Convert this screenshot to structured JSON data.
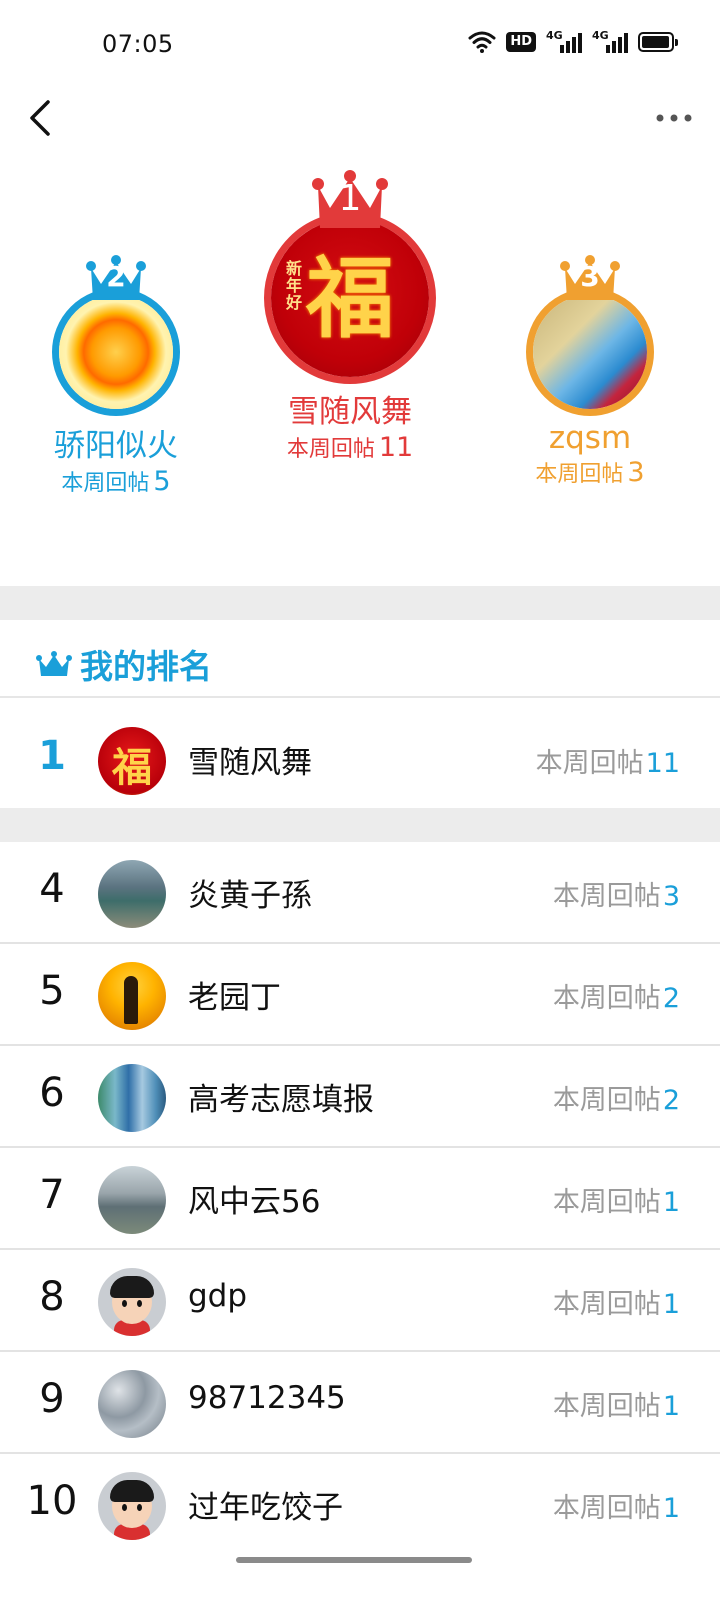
{
  "status": {
    "time": "07:05",
    "hd_label": "HD",
    "sim1_label": "4G",
    "sim2_label": "4G"
  },
  "header": {
    "back_icon": "chevron-left-icon",
    "more_icon": "more-dots-icon"
  },
  "podium": {
    "first": {
      "rank": "1",
      "name": "雪随风舞",
      "count_label": "本周回帖",
      "count": "11",
      "color": "#e23a3a",
      "avatar_text": "福",
      "avatar_side_text": "新年好"
    },
    "second": {
      "rank": "2",
      "name": "骄阳似火",
      "count_label": "本周回帖",
      "count": "5",
      "color": "#1a9fd9"
    },
    "third": {
      "rank": "3",
      "name": "zqsm",
      "count_label": "本周回帖",
      "count": "3",
      "color": "#f0a030"
    }
  },
  "my_rank": {
    "title": "我的排名",
    "rank": "1",
    "name": "雪随风舞",
    "count_label": "本周回帖",
    "count": "11",
    "avatar_text": "福"
  },
  "list": [
    {
      "rank": "4",
      "name": "炎黄子孫",
      "count_label": "本周回帖",
      "count": "3"
    },
    {
      "rank": "5",
      "name": "老园丁",
      "count_label": "本周回帖",
      "count": "2"
    },
    {
      "rank": "6",
      "name": "高考志愿填报",
      "count_label": "本周回帖",
      "count": "2"
    },
    {
      "rank": "7",
      "name": "风中云56",
      "count_label": "本周回帖",
      "count": "1"
    },
    {
      "rank": "8",
      "name": "gdp",
      "count_label": "本周回帖",
      "count": "1"
    },
    {
      "rank": "9",
      "name": "98712345",
      "count_label": "本周回帖",
      "count": "1"
    },
    {
      "rank": "10",
      "name": "过年吃饺子",
      "count_label": "本周回帖",
      "count": "1"
    }
  ],
  "colors": {
    "accent": "#1a9fd9",
    "first": "#e23a3a",
    "second": "#1a9fd9",
    "third": "#f0a030",
    "muted": "#9a9a9a"
  }
}
